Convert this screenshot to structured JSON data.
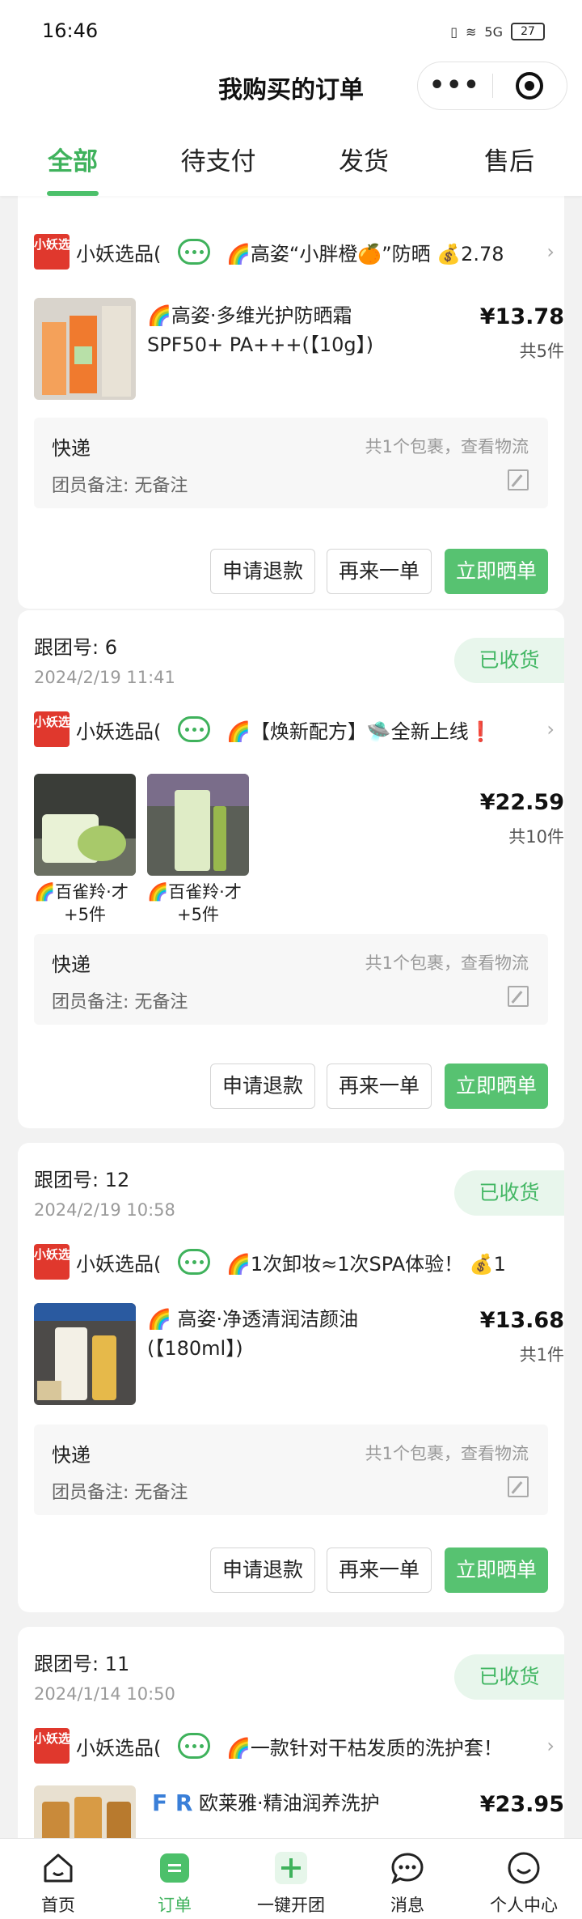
{
  "status": {
    "time": "16:46",
    "battery": "27",
    "signal": "5G"
  },
  "nav": {
    "title": "我购买的订单",
    "more": "•••"
  },
  "tabs": [
    "全部",
    "待支付",
    "发货",
    "售后"
  ],
  "orders": [
    {
      "group_no": "",
      "date": "",
      "status": "",
      "shop_logo": "小妖选品",
      "shop": "小妖选品(",
      "desc": "🌈高姿“小胖橙🍊”防晒 💰2.78",
      "items": [
        {
          "name": "🌈高姿·多维光护防晒霜SPF50+ PA+++(【10g】)"
        }
      ],
      "price": "¥13.78",
      "qty": "共5件",
      "express": "快递",
      "express_link": "共1个包裹，查看物流",
      "note": "团员备注: 无备注",
      "buttons": [
        "申请退款",
        "再来一单",
        "立即晒单"
      ]
    },
    {
      "group_no": "跟团号: 6",
      "date": "2024/2/19 11:41",
      "status": "已收货",
      "shop_logo": "小妖选品",
      "shop": "小妖选品(",
      "desc": "🌈【焕新配方】🛸全新上线❗",
      "items": [
        {
          "name": "🌈百雀羚·才",
          "count": "+5件"
        },
        {
          "name": "🌈百雀羚·才",
          "count": "+5件"
        }
      ],
      "price": "¥22.59",
      "qty": "共10件",
      "express": "快递",
      "express_link": "共1个包裹，查看物流",
      "note": "团员备注: 无备注",
      "buttons": [
        "申请退款",
        "再来一单",
        "立即晒单"
      ]
    },
    {
      "group_no": "跟团号: 12",
      "date": "2024/2/19 10:58",
      "status": "已收货",
      "shop_logo": "小妖选品",
      "shop": "小妖选品(",
      "desc": "🌈1次卸妆≈1次SPA体验！ 💰1",
      "items": [
        {
          "name": "🌈 高姿·净透清润洁颜油(【180ml】)"
        }
      ],
      "price": "¥13.68",
      "qty": "共1件",
      "express": "快递",
      "express_link": "共1个包裹，查看物流",
      "note": "团员备注: 无备注",
      "buttons": [
        "申请退款",
        "再来一单",
        "立即晒单"
      ]
    },
    {
      "group_no": "跟团号: 11",
      "date": "2024/1/14 10:50",
      "status": "已收货",
      "shop_logo": "小妖选品",
      "shop": "小妖选品(",
      "desc": "🌈一款针对干枯发质的洗护套！",
      "items": [
        {
          "name": "欧莱雅·精油润养洗护",
          "brand": "F R"
        }
      ],
      "price": "¥23.95",
      "qty": ""
    }
  ],
  "tabbar": [
    "首页",
    "订单",
    "一键开团",
    "消息",
    "个人中心"
  ],
  "colors": {
    "accent": "#4cc06a",
    "shop_logo": "#e0382d"
  }
}
